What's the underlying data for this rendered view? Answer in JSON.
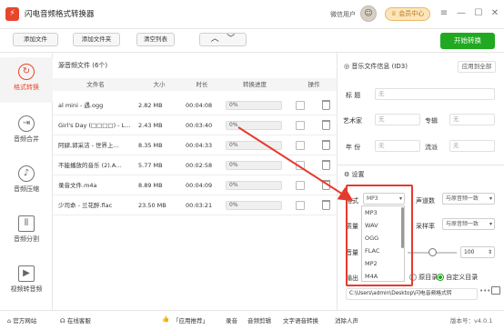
{
  "app": {
    "title": "闪电音频格式转换器",
    "wechat": "微信用户",
    "vip": "会员中心"
  },
  "toolbar": {
    "add_file": "添加文件",
    "add_folder": "添加文件夹",
    "clear": "清空列表",
    "start": "开始转换"
  },
  "sidebar": [
    {
      "label": "格式转换",
      "icon": "refresh-icon"
    },
    {
      "label": "音频合并",
      "icon": "merge-icon"
    },
    {
      "label": "音频压缩",
      "icon": "compress-icon"
    },
    {
      "label": "音频分割",
      "icon": "split-icon"
    },
    {
      "label": "视频转音频",
      "icon": "video-icon"
    }
  ],
  "filelist": {
    "header": "源音频文件 (6个)",
    "columns": [
      "文件名",
      "大小",
      "时长",
      "转换进度",
      "操作"
    ],
    "rows": [
      {
        "name": "al mini - 遇.ogg",
        "size": "2.82 MB",
        "duration": "00:04:08",
        "progress": "0%"
      },
      {
        "name": "Girl's Day (□□□□) - L...",
        "size": "2.43 MB",
        "duration": "00:03:40",
        "progress": "0%"
      },
      {
        "name": "阿肆,郭采洁 - 世界上...",
        "size": "8.35 MB",
        "duration": "00:04:33",
        "progress": "0%"
      },
      {
        "name": "不能播放的音乐 (2).A...",
        "size": "5.77 MB",
        "duration": "00:02:58",
        "progress": "0%"
      },
      {
        "name": "录音文件.m4a",
        "size": "8.89 MB",
        "duration": "00:04:09",
        "progress": "0%"
      },
      {
        "name": "少司命 - 兰花醉.flac",
        "size": "23.50 MB",
        "duration": "00:03:21",
        "progress": "0%"
      }
    ]
  },
  "id3": {
    "header": "音乐文件信息 (ID3)",
    "apply_all": "应用到全部",
    "title_label": "标 题",
    "title_placeholder": "无",
    "artist_label": "艺术家",
    "artist_placeholder": "无",
    "album_label": "专辑",
    "album_placeholder": "无",
    "year_label": "年 份",
    "year_placeholder": "无",
    "genre_label": "流派",
    "genre_placeholder": "无"
  },
  "settings": {
    "header": "设置",
    "format_label": "格式",
    "format_value": "MP3",
    "channels_label": "声道数",
    "channels_value": "与原音频一致",
    "quality_label": "质量",
    "samplerate_label": "采样率",
    "samplerate_value": "与原音频一致",
    "volume_label": "音量",
    "volume_value": "100",
    "volume_fraction": 0.5,
    "output_label": "输出",
    "src_dir": "原目录",
    "custom_dir": "自定义目录",
    "path": "C:\\Users\\admin\\Desktop\\闪电音频格式转",
    "more": "•••"
  },
  "format_options": [
    "MP3",
    "WAV",
    "OGG",
    "FLAC",
    "MP2",
    "M4A"
  ],
  "bottom": {
    "website": "官方网站",
    "support": "在线客服",
    "recommend": "「应用推荐」",
    "links": [
      "录音",
      "音频剪辑",
      "文字语音转换",
      "消除人声"
    ],
    "version": "版本号：v4.0.1"
  },
  "colors": {
    "accent": "#e8452c",
    "green": "#21a921",
    "highlight": "#e53b2e"
  }
}
